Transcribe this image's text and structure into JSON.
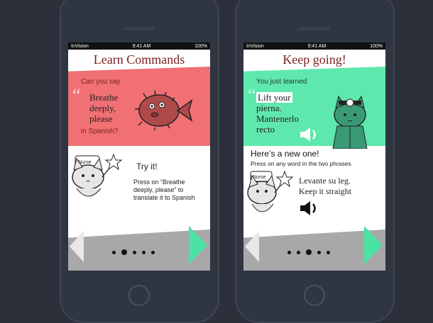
{
  "status": {
    "carrier": "InVision",
    "time": "9:41 AM",
    "battery": "100%"
  },
  "left": {
    "title": "Learn Commands",
    "question_prefix": "Can you say",
    "phrase": [
      "Breathe",
      "deeply,",
      "please"
    ],
    "question_suffix": "in Spanish?",
    "try_label": "Try it!",
    "instruction": [
      "Press on “Breathe",
      "deeply, please” to",
      "translate it to Spanish"
    ],
    "band_color": "#f07074"
  },
  "right": {
    "title": "Keep going!",
    "learned_label": "You just learned",
    "learned_phrase": [
      "Lift your",
      "pierna.",
      "Mantenerlo",
      "recto"
    ],
    "new_heading": "Here’s a new one!",
    "new_instruction": "Press on any word in the two phrases",
    "new_phrase": [
      "Levante su leg.",
      "Keep it straight"
    ],
    "band_color": "#5ee8ad"
  },
  "colors": {
    "accent": "#4be3a3",
    "title": "#7a1f1f",
    "nav": "#a8a8a8"
  },
  "icons": {
    "speaker": "speaker-icon",
    "next": "next-arrow-icon",
    "prev": "prev-arrow-icon"
  }
}
